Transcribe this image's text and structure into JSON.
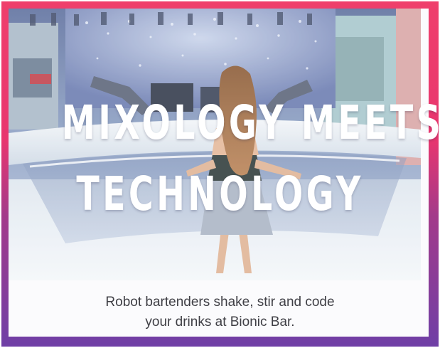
{
  "headline": {
    "line1": "MIXOLOGY MEETS",
    "line2": "TECHNOLOGY"
  },
  "caption": {
    "line1": "Robot bartenders shake, stir and code",
    "line2": "your drinks at Bionic Bar."
  },
  "colors": {
    "frame_top": "#ef3f6b",
    "frame_bottom": "#6f3fa6",
    "caption_text": "#3f3f45"
  }
}
